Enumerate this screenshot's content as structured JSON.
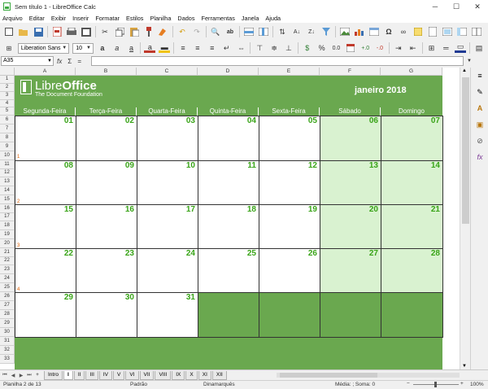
{
  "window": {
    "title": "Sem título 1 - LibreOffice Calc",
    "controls": [
      "─",
      "☐",
      "✕"
    ]
  },
  "menu": [
    "Arquivo",
    "Editar",
    "Exibir",
    "Inserir",
    "Formatar",
    "Estilos",
    "Planilha",
    "Dados",
    "Ferramentas",
    "Janela",
    "Ajuda"
  ],
  "toolbar": {
    "font_name": "Liberation Sans",
    "font_size": "10"
  },
  "formula": {
    "cell_ref": "A35",
    "content": ""
  },
  "columns": [
    "A",
    "B",
    "C",
    "D",
    "E",
    "F",
    "G"
  ],
  "rows": [
    "1",
    "2",
    "3",
    "4",
    "5",
    "6",
    "7",
    "8",
    "9",
    "10",
    "11",
    "12",
    "13",
    "14",
    "15",
    "16",
    "17",
    "18",
    "19",
    "20",
    "21",
    "22",
    "23",
    "24",
    "25",
    "26",
    "27",
    "28",
    "29",
    "30",
    "31",
    "32",
    "33"
  ],
  "calendar": {
    "logo_brand_light": "Libre",
    "logo_brand_bold": "Office",
    "logo_subtitle": "The Document Foundation",
    "month": "janeiro 2018",
    "weekdays": [
      "Segunda-Feira",
      "Terça-Feira",
      "Quarta-Feira",
      "Quinta-Feira",
      "Sexta-Feira",
      "Sábado",
      "Domingo"
    ],
    "weeks": [
      [
        "01",
        "02",
        "03",
        "04",
        "05",
        "06",
        "07"
      ],
      [
        "08",
        "09",
        "10",
        "11",
        "12",
        "13",
        "14"
      ],
      [
        "15",
        "16",
        "17",
        "18",
        "19",
        "20",
        "21"
      ],
      [
        "22",
        "23",
        "24",
        "25",
        "26",
        "27",
        "28"
      ],
      [
        "29",
        "30",
        "31",
        "",
        "",
        "",
        ""
      ]
    ],
    "week_numbers": [
      "1",
      "2",
      "3",
      "4"
    ]
  },
  "sheet_tabs": [
    "Intro",
    "I",
    "II",
    "III",
    "IV",
    "V",
    "VI",
    "VII",
    "VIII",
    "IX",
    "X",
    "XI",
    "XII"
  ],
  "active_tab": "I",
  "status": {
    "sheet": "Planilha 2 de 13",
    "style": "Padrão",
    "language": "Dinamarquês",
    "summary": "Média: ; Soma: 0",
    "zoom": "100%"
  },
  "colors": {
    "green_band": "#6aa84f",
    "weekend_fill": "#d9f2d0",
    "day_number": "#38a317"
  }
}
